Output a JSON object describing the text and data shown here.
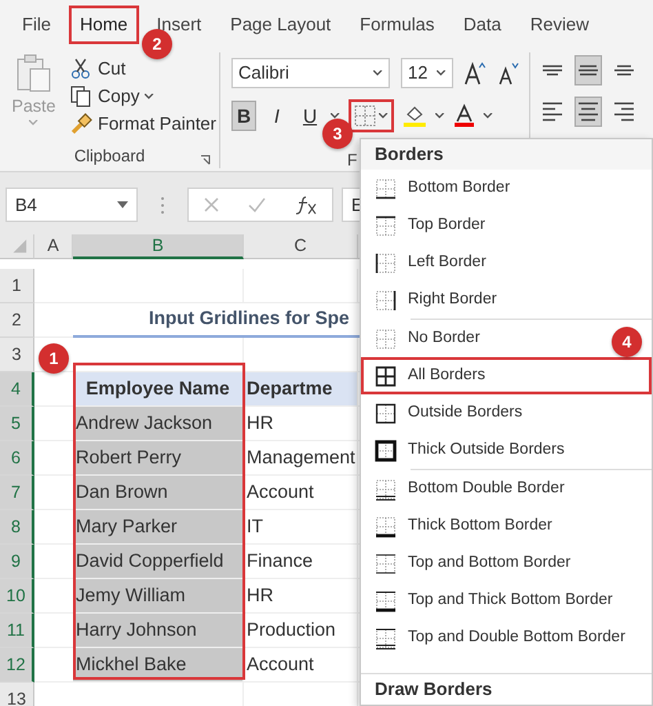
{
  "tabs": [
    {
      "label": "File",
      "selected": false,
      "highlighted": false
    },
    {
      "label": "Home",
      "selected": true,
      "highlighted": true,
      "callout": "2"
    },
    {
      "label": "Insert",
      "selected": false,
      "highlighted": false
    },
    {
      "label": "Page Layout",
      "selected": false,
      "highlighted": false
    },
    {
      "label": "Formulas",
      "selected": false,
      "highlighted": false
    },
    {
      "label": "Data",
      "selected": false,
      "highlighted": false
    },
    {
      "label": "Review",
      "selected": false,
      "highlighted": false
    }
  ],
  "clipboard": {
    "paste": "Paste",
    "commands": [
      {
        "label": "Cut",
        "kind": "cut"
      },
      {
        "label": "Copy",
        "kind": "copy"
      },
      {
        "label": "Format Painter",
        "kind": "painter"
      }
    ],
    "label": "Clipboard"
  },
  "font": {
    "font_name": "Calibri",
    "font_size": "12",
    "styles": [
      {
        "label": "B",
        "kind": "bold",
        "selected": true
      },
      {
        "label": "I",
        "kind": "italic",
        "selected": false
      },
      {
        "label": "U",
        "kind": "underline",
        "selected": false
      }
    ],
    "borders_button": {
      "highlighted": true,
      "callout": "3"
    },
    "label": "F"
  },
  "alignment": {
    "buttons": [
      {
        "kind": "top",
        "selected": false
      },
      {
        "kind": "middle",
        "selected": true
      },
      {
        "kind": "bottom",
        "selected": false
      },
      {
        "kind": "left",
        "selected": false
      },
      {
        "kind": "center",
        "selected": true
      },
      {
        "kind": "right",
        "selected": false
      }
    ]
  },
  "formula_bar": {
    "name_box": "B4",
    "content": "E"
  },
  "sheet": {
    "columns": [
      {
        "label": "A",
        "selected": false
      },
      {
        "label": "B",
        "selected": true
      },
      {
        "label": "C",
        "selected": false
      }
    ],
    "rows": [
      {
        "label": "1",
        "selected": false
      },
      {
        "label": "2",
        "selected": false
      },
      {
        "label": "3",
        "selected": false
      },
      {
        "label": "4",
        "selected": true
      },
      {
        "label": "5",
        "selected": true
      },
      {
        "label": "6",
        "selected": true
      },
      {
        "label": "7",
        "selected": true
      },
      {
        "label": "8",
        "selected": true
      },
      {
        "label": "9",
        "selected": true
      },
      {
        "label": "10",
        "selected": true
      },
      {
        "label": "11",
        "selected": true
      },
      {
        "label": "12",
        "selected": true
      },
      {
        "label": "13",
        "selected": false
      }
    ],
    "title": "Input Gridlines for Spe",
    "header": [
      "Employee Name",
      "Departme"
    ],
    "records": [
      [
        "Andrew Jackson",
        "HR"
      ],
      [
        "Robert Perry",
        "Management"
      ],
      [
        "Dan Brown",
        "Account"
      ],
      [
        "Mary Parker",
        "IT"
      ],
      [
        "David Copperfield",
        "Finance"
      ],
      [
        "Jemy William",
        "HR"
      ],
      [
        "Harry Johnson",
        "Production"
      ],
      [
        "Mickhel Bake",
        "Account"
      ]
    ],
    "selection_callout": "1"
  },
  "borders_menu": {
    "title": "Borders",
    "sections": [
      [
        {
          "label": "Bottom Border",
          "kind": "bottom",
          "highlighted": false
        },
        {
          "label": "Top Border",
          "kind": "top",
          "highlighted": false
        },
        {
          "label": "Left Border",
          "kind": "left",
          "highlighted": false
        },
        {
          "label": "Right Border",
          "kind": "right",
          "highlighted": false
        }
      ],
      [
        {
          "label": "No Border",
          "kind": "none",
          "highlighted": false
        },
        {
          "label": "All Borders",
          "kind": "all",
          "highlighted": true,
          "callout": "4"
        },
        {
          "label": "Outside Borders",
          "kind": "outside",
          "highlighted": false
        },
        {
          "label": "Thick Outside Borders",
          "kind": "thick-outside",
          "highlighted": false
        }
      ],
      [
        {
          "label": "Bottom Double Border",
          "kind": "bottom-double",
          "highlighted": false
        },
        {
          "label": "Thick Bottom Border",
          "kind": "thick-bottom",
          "highlighted": false
        },
        {
          "label": "Top and Bottom Border",
          "kind": "top-bottom",
          "highlighted": false
        },
        {
          "label": "Top and Thick Bottom Border",
          "kind": "top-thick-bottom",
          "highlighted": false
        },
        {
          "label": "Top and Double Bottom Border",
          "kind": "top-double-bottom",
          "highlighted": false
        }
      ]
    ],
    "footer": "Draw Borders"
  }
}
